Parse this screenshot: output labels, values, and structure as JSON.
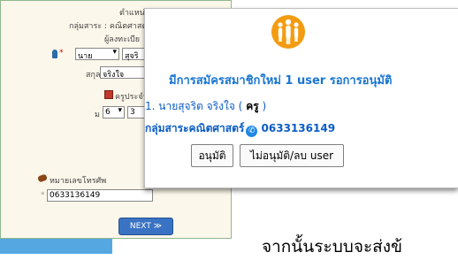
{
  "background_form": {
    "position_label": "ตำแหน่ง : ค",
    "group_label": "กลุ่มสาระ : คณิตศาสต",
    "register_label": "ผู้ลงทะเบีย",
    "prefix_value": "นาย",
    "firstname_value": "สุจริ",
    "surname_label": "สกุล",
    "surname_value": "จริงใจ",
    "teacher_type_label": "ครูประจำ",
    "month_value": "6",
    "year_value": "3",
    "day_prefix": "ม",
    "phone_label": "หมายเลขโทรศัพ",
    "phone_value": "0633136149",
    "next_button": "NEXT ≫"
  },
  "caption_text": "จากนั้นระบบจะส่งข้",
  "popup": {
    "notice": "มีการสมัครสมาชิกใหม่ 1 user รอการอนุมัติ",
    "user_prefix": "1. นายสุจริต จริงใจ (",
    "user_role": "ครู",
    "user_suffix": ")",
    "group_text": "กลุ่มสาระคณิตศาสตร์",
    "phone_text": "0633136149",
    "approve_label": "อนุมัติ",
    "reject_label": "ไม่อนุมัติ/ลบ user"
  },
  "colors": {
    "accent_blue": "#1a75d1",
    "logo_orange": "#f39c12"
  }
}
